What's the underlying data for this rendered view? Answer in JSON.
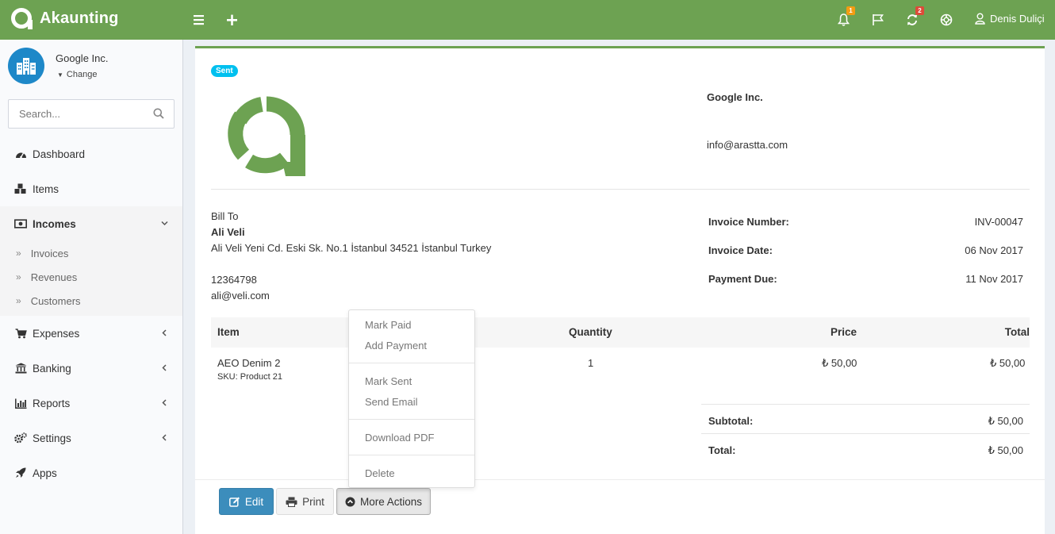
{
  "app": {
    "name": "Akaunting"
  },
  "header": {
    "notifications_count": "1",
    "updates_count": "2",
    "user_name": "Denis Duliçi"
  },
  "sidebar": {
    "company_name": "Google Inc.",
    "company_change": "Change",
    "search_placeholder": "Search...",
    "menu": [
      {
        "label": "Dashboard",
        "icon": "dashboard-icon"
      },
      {
        "label": "Items",
        "icon": "cubes-icon"
      },
      {
        "label": "Incomes",
        "icon": "money-icon",
        "expanded": true
      },
      {
        "label": "Expenses",
        "icon": "cart-icon"
      },
      {
        "label": "Banking",
        "icon": "bank-icon"
      },
      {
        "label": "Reports",
        "icon": "bar-chart-icon"
      },
      {
        "label": "Settings",
        "icon": "gears-icon"
      },
      {
        "label": "Apps",
        "icon": "rocket-icon"
      }
    ],
    "incomes_submenu": [
      "Invoices",
      "Revenues",
      "Customers"
    ]
  },
  "invoice": {
    "status": "Sent",
    "company_name": "Google Inc.",
    "company_email": "info@arastta.com",
    "bill_to_label": "Bill To",
    "customer_name": "Ali Veli",
    "customer_address": "Ali Veli Yeni Cd. Eski Sk. No.1 İstanbul 34521 İstanbul Turkey",
    "customer_tax_number": "12364798",
    "customer_email": "ali@veli.com",
    "meta": [
      {
        "label": "Invoice Number:",
        "value": "INV-00047"
      },
      {
        "label": "Invoice Date:",
        "value": "06 Nov 2017"
      },
      {
        "label": "Payment Due:",
        "value": "11 Nov 2017"
      }
    ],
    "table_headers": {
      "item": "Item",
      "quantity": "Quantity",
      "price": "Price",
      "total": "Total"
    },
    "items": [
      {
        "name": "AEO Denim 2",
        "sku": "SKU: Product 21",
        "quantity": "1",
        "price": "₺ 50,00",
        "total": "₺ 50,00"
      }
    ],
    "totals": [
      {
        "label": "Subtotal:",
        "value": "₺ 50,00"
      },
      {
        "label": "Total:",
        "value": "₺ 50,00"
      }
    ]
  },
  "actions": {
    "edit": "Edit",
    "print": "Print",
    "more": "More Actions",
    "dropdown": {
      "mark_paid": "Mark Paid",
      "add_payment": "Add Payment",
      "mark_sent": "Mark Sent",
      "send_email": "Send Email",
      "download_pdf": "Download PDF",
      "delete": "Delete"
    }
  },
  "colors": {
    "brand": "#6da252",
    "primary_button": "#3c8dbc",
    "status_badge": "#00c0ef"
  }
}
